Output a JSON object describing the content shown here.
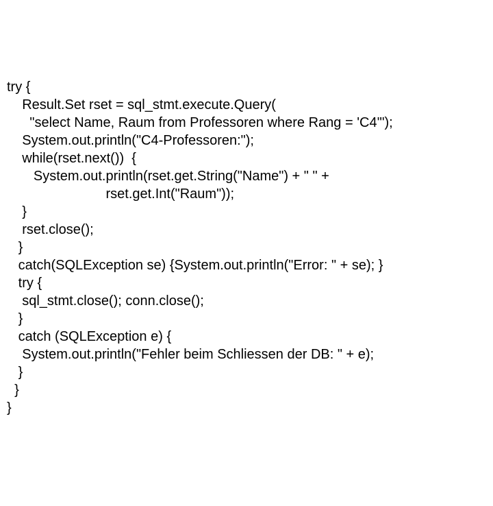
{
  "code": {
    "line01": "try {",
    "line02": "    Result.Set rset = sql_stmt.execute.Query(",
    "line03": "      \"select Name, Raum from Professoren where Rang = 'C4'\");",
    "line04": "    System.out.println(\"C4-Professoren:\");",
    "line05": "    while(rset.next())  {",
    "line06": "       System.out.println(rset.get.String(\"Name\") + \" \" +",
    "line07": "                          rset.get.Int(\"Raum\"));",
    "line08": "    }",
    "line09": "    rset.close();",
    "line10": "   }",
    "line11": "   catch(SQLException se) {System.out.println(\"Error: \" + se); }",
    "line12": "   try {",
    "line13": "    sql_stmt.close(); conn.close();",
    "line14": "   }",
    "line15": "   catch (SQLException e) {",
    "line16": "    System.out.println(\"Fehler beim Schliessen der DB: \" + e);",
    "line17": "   }",
    "line18": "  }",
    "line19": "}"
  }
}
